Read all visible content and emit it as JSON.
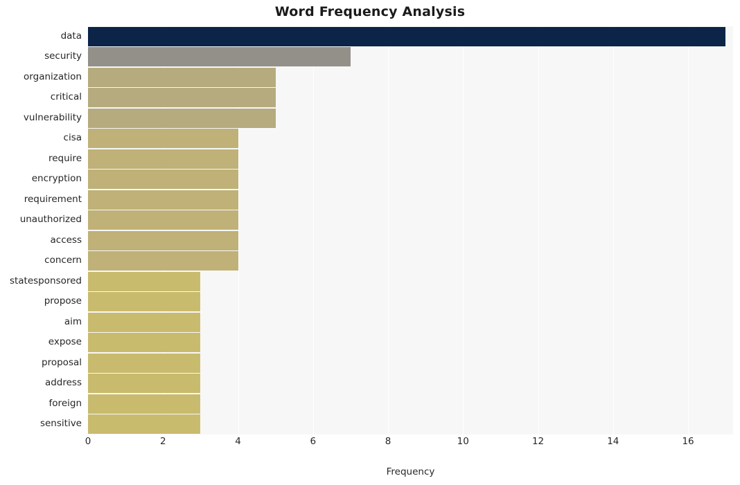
{
  "chart_data": {
    "type": "bar",
    "orientation": "horizontal",
    "title": "Word Frequency Analysis",
    "xlabel": "Frequency",
    "ylabel": "",
    "xlim": [
      0,
      17.2
    ],
    "xticks": [
      0,
      2,
      4,
      6,
      8,
      10,
      12,
      14,
      16
    ],
    "grid": "vertical",
    "legend": null,
    "categories": [
      "data",
      "security",
      "organization",
      "critical",
      "vulnerability",
      "cisa",
      "require",
      "encryption",
      "requirement",
      "unauthorized",
      "access",
      "concern",
      "statesponsored",
      "propose",
      "aim",
      "expose",
      "proposal",
      "address",
      "foreign",
      "sensitive"
    ],
    "values": [
      17,
      7,
      5,
      5,
      5,
      4,
      4,
      4,
      4,
      4,
      4,
      4,
      3,
      3,
      3,
      3,
      3,
      3,
      3,
      3
    ],
    "bar_colors": [
      "#0b2447",
      "#93908a",
      "#b5ab7f",
      "#b5ab7f",
      "#b5ab7f",
      "#bfb177",
      "#bfb177",
      "#bfb177",
      "#bfb177",
      "#bfb177",
      "#bfb177",
      "#bfb177",
      "#c9bb6e",
      "#c9bb6e",
      "#c9bb6e",
      "#c9bb6e",
      "#c9bb6e",
      "#c9bb6e",
      "#c9bb6e",
      "#c9bb6e"
    ],
    "plot_background": "#f7f7f7",
    "grid_color": "#ffffff",
    "figure_background": "#ffffff"
  }
}
